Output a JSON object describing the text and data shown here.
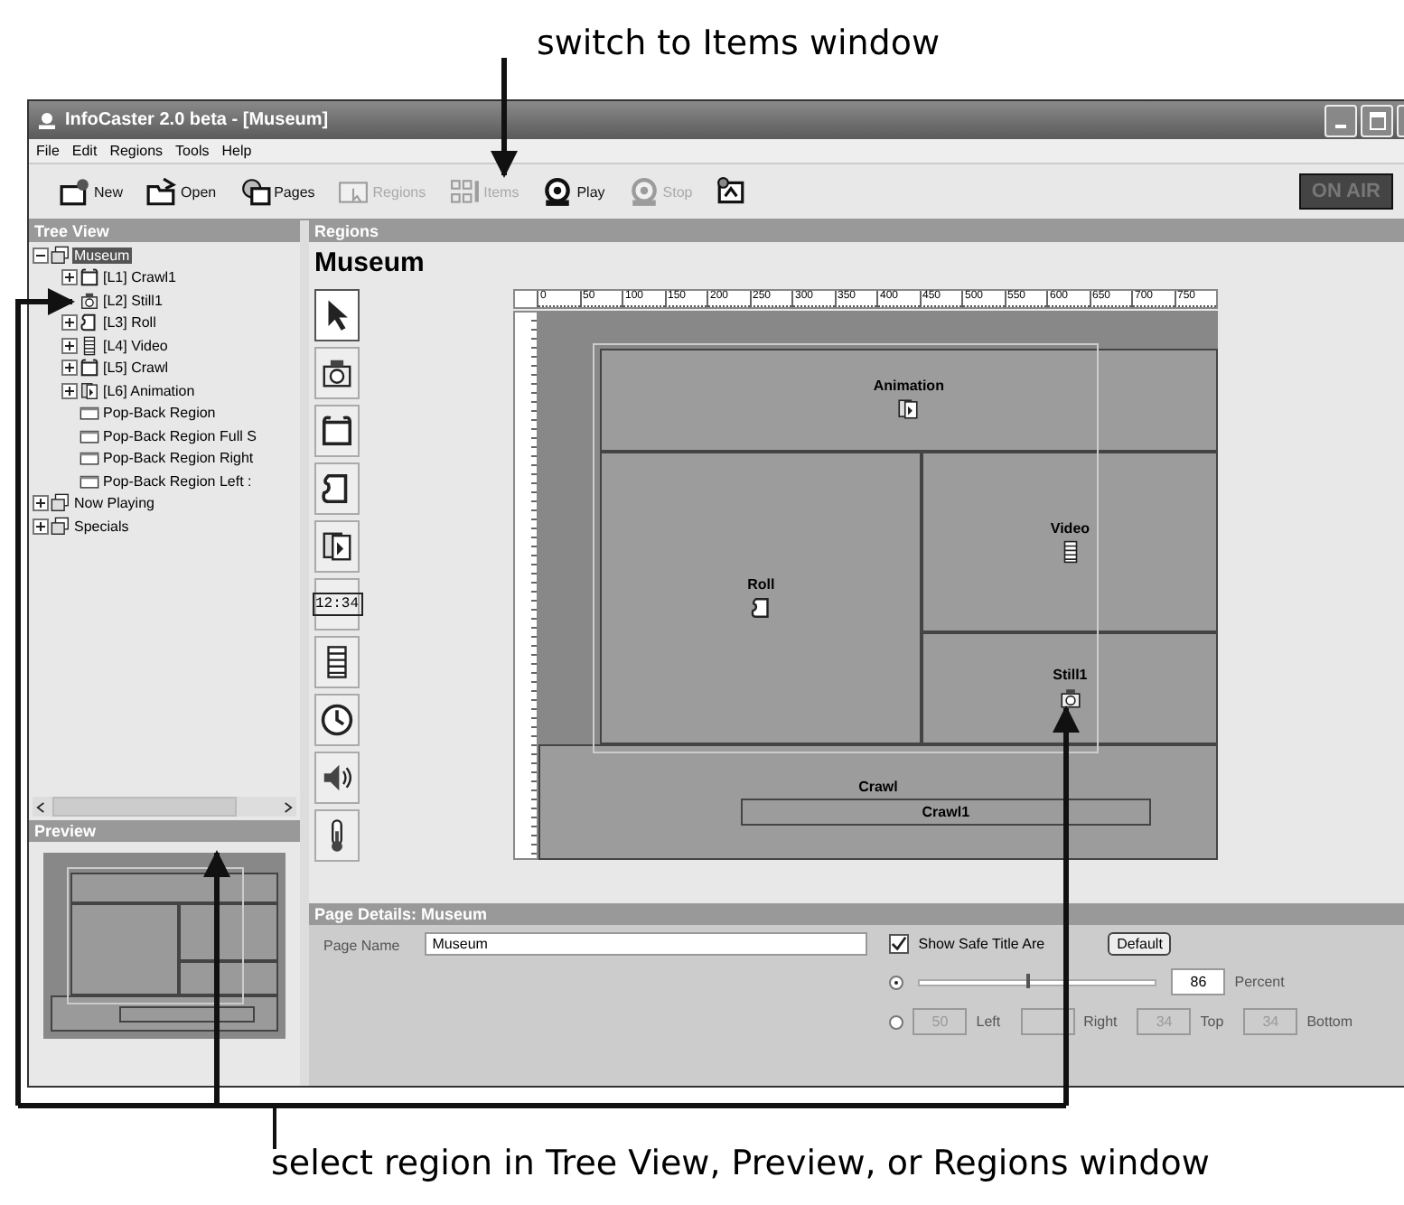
{
  "captions": {
    "top": "switch to Items window",
    "bottom": "select region in Tree View, Preview, or Regions window"
  },
  "window": {
    "title": "InfoCaster 2.0 beta  - [Museum]"
  },
  "menu": [
    "File",
    "Edit",
    "Regions",
    "Tools",
    "Help"
  ],
  "toolbar": [
    {
      "label": "New",
      "kind": "new",
      "disabled": false
    },
    {
      "label": "Open",
      "kind": "open",
      "disabled": false
    },
    {
      "label": "Pages",
      "kind": "pages",
      "disabled": false
    },
    {
      "label": "Regions",
      "kind": "regions",
      "disabled": true
    },
    {
      "label": "Items",
      "kind": "items",
      "disabled": true
    },
    {
      "label": "Play",
      "kind": "play",
      "disabled": false
    },
    {
      "label": "Stop",
      "kind": "play",
      "disabled": true
    },
    {
      "kind": "monitor",
      "disabled": false
    }
  ],
  "on_air": "ON AIR",
  "tree_view": {
    "title": "Tree View",
    "items": [
      {
        "label": "Museum",
        "kind": "page",
        "expanded": true,
        "selected": true,
        "children": [
          {
            "label": "[L1] Crawl1",
            "kind": "crawl",
            "expanded": false,
            "selected": false
          },
          {
            "label": "[L2] Still1",
            "kind": "camera",
            "selected": false
          },
          {
            "label": "[L3] Roll",
            "kind": "roll",
            "expanded": false,
            "selected": false
          },
          {
            "label": "[L4] Video",
            "kind": "video",
            "expanded": false,
            "selected": false
          },
          {
            "label": "[L5] Crawl",
            "kind": "crawl",
            "expanded": false,
            "selected": false
          },
          {
            "label": "[L6] Animation",
            "kind": "animation",
            "expanded": false,
            "selected": false
          },
          {
            "label": "Pop-Back Region",
            "kind": "popback",
            "selected": false
          },
          {
            "label": "Pop-Back Region Full S",
            "kind": "popback",
            "selected": false
          },
          {
            "label": "Pop-Back Region Right",
            "kind": "popback",
            "selected": false
          },
          {
            "label": "Pop-Back Region Left :",
            "kind": "popback",
            "selected": false
          }
        ]
      },
      {
        "label": "Now Playing",
        "kind": "page",
        "expanded": false,
        "selected": false
      },
      {
        "label": "Specials",
        "kind": "page",
        "expanded": false,
        "selected": false
      }
    ]
  },
  "preview": {
    "title": "Preview"
  },
  "regions_panel": {
    "title": "Regions",
    "page_title": "Museum",
    "tools": [
      {
        "kind": "pointer",
        "selected": true
      },
      {
        "kind": "camera",
        "selected": false
      },
      {
        "kind": "crawl",
        "selected": false
      },
      {
        "kind": "roll",
        "selected": false
      },
      {
        "kind": "animation",
        "selected": false
      },
      {
        "kind": "digits",
        "label": "12:34",
        "selected": false
      },
      {
        "kind": "video",
        "selected": false
      },
      {
        "kind": "clock",
        "selected": false
      },
      {
        "kind": "speaker",
        "selected": false
      },
      {
        "kind": "thermometer",
        "selected": false
      }
    ],
    "ruler": [
      "0",
      "50",
      "100",
      "150",
      "200",
      "250",
      "300",
      "350",
      "400",
      "450",
      "500",
      "550",
      "600",
      "650",
      "700",
      "750"
    ],
    "regions": [
      {
        "name": "Animation",
        "kind": "animation"
      },
      {
        "name": "Roll",
        "kind": "roll"
      },
      {
        "name": "Video",
        "kind": "video"
      },
      {
        "name": "Still1",
        "kind": "camera"
      },
      {
        "name": "Crawl",
        "kind": "crawl",
        "inner_label": "Crawl1"
      }
    ]
  },
  "page_details": {
    "title": "Page Details: Museum",
    "page_name_label": "Page Name",
    "page_name": "Museum",
    "safe_title": {
      "label": "Show Safe Title Are",
      "checked": true
    },
    "default_button": "Default",
    "percent_mode": {
      "selected": true,
      "level": 0.45,
      "value": "86",
      "unit": "Percent"
    },
    "margin_mode": {
      "selected": false,
      "fields": [
        {
          "value": "50",
          "label": "Left"
        },
        {
          "label": "Right"
        },
        {
          "value": "34",
          "label": "Top"
        },
        {
          "value": "34",
          "label": "Bottom"
        }
      ]
    }
  }
}
